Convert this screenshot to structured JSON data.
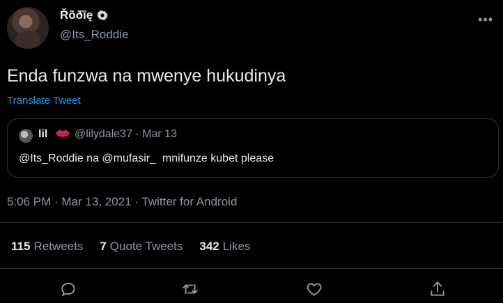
{
  "author": {
    "name": "Řõðȉę",
    "handle": "@Its_Roddie"
  },
  "tweet": {
    "text": "Enda funzwa na mwenye hukudinya",
    "translate_label": "Translate Tweet",
    "timestamp": "5:06 PM · Mar 13, 2021 · Twitter for Android"
  },
  "quoted": {
    "name": "lil",
    "meta": "@lilydale37 · Mar 13",
    "text": "@Its_Roddie na @mufasir_  mnifunze kubet please"
  },
  "stats": {
    "retweets_count": "115",
    "retweets_label": "Retweets",
    "quotes_count": "7",
    "quotes_label": "Quote Tweets",
    "likes_count": "342",
    "likes_label": "Likes"
  },
  "colors": {
    "background": "#000000",
    "text_primary": "#e7e9ea",
    "text_secondary": "#8b98a5",
    "link": "#1d9bf0",
    "divider": "#2f3336"
  },
  "icons": {
    "reply": "reply-icon",
    "retweet": "retweet-icon",
    "like": "like-icon",
    "share": "share-icon",
    "more": "more-icon",
    "verified": "verified-badge-icon"
  }
}
